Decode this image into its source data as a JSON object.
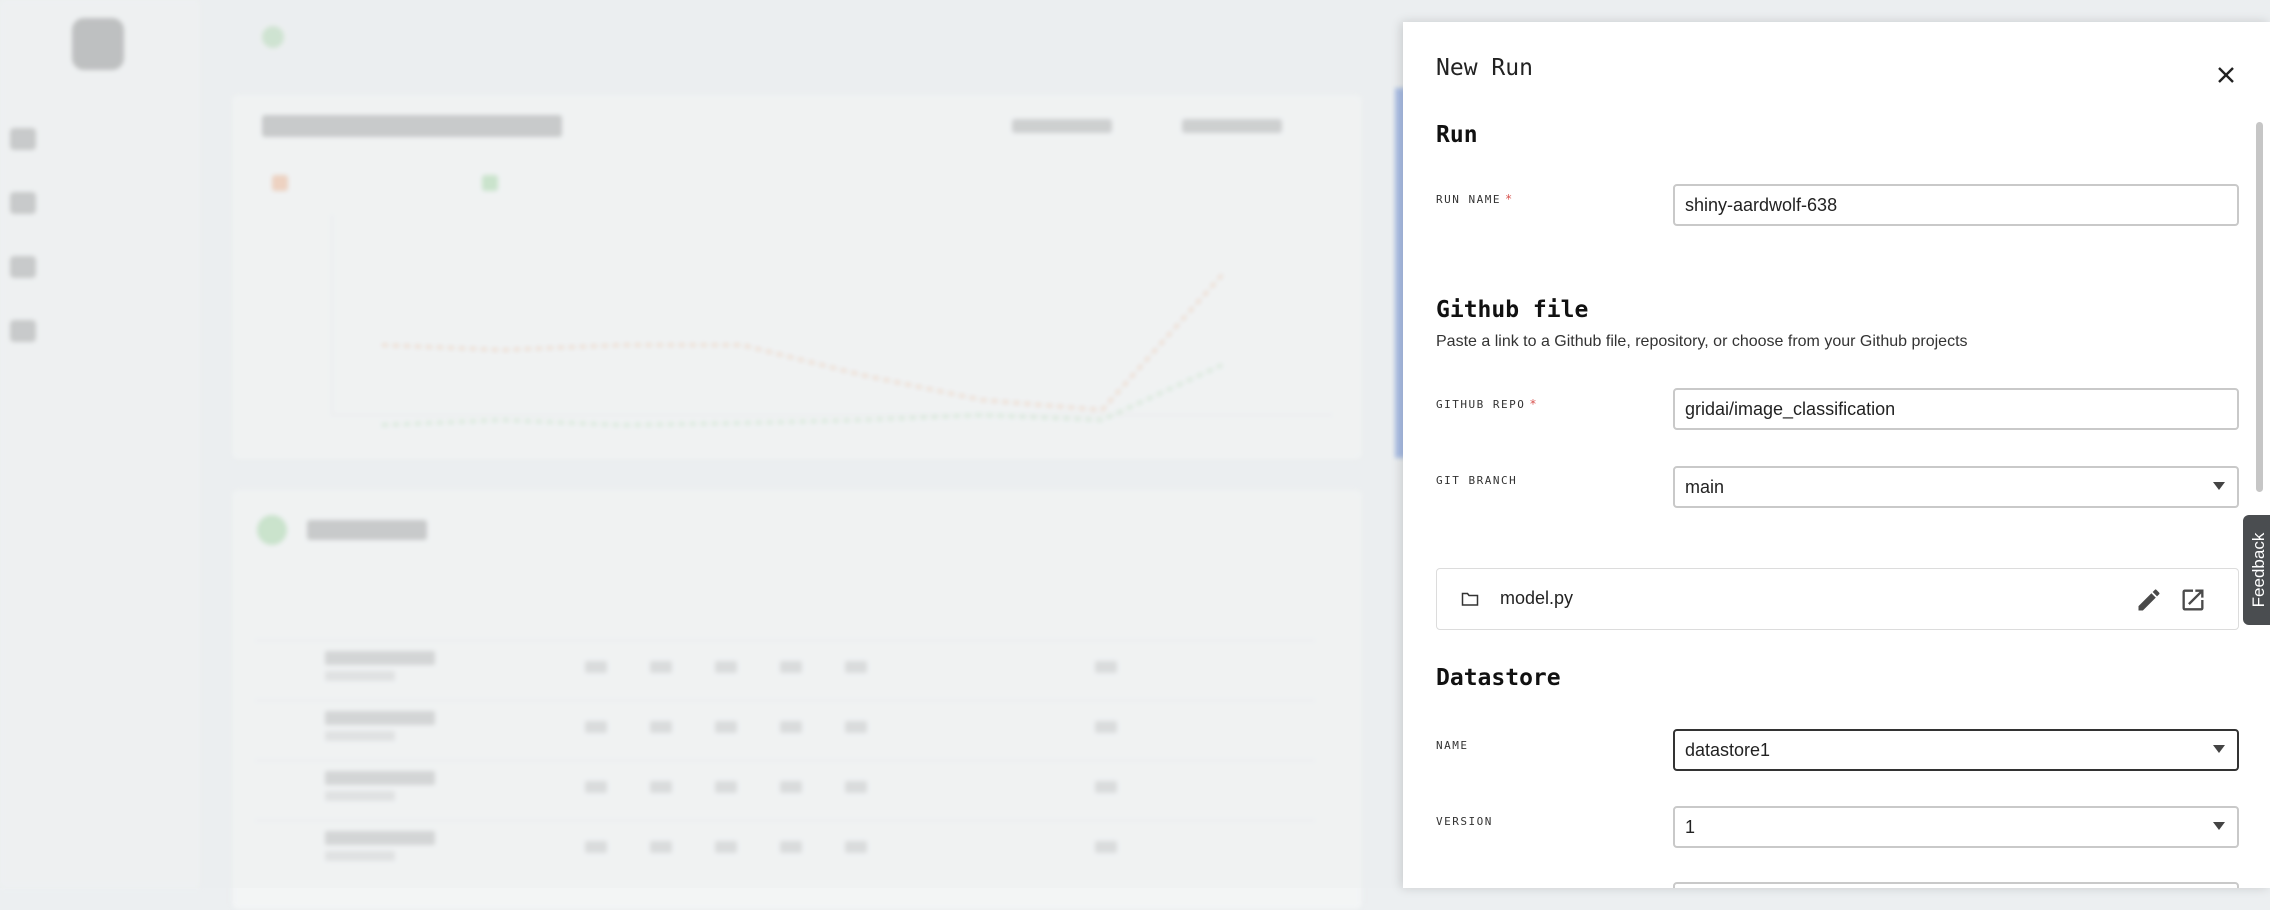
{
  "drawer": {
    "title": "New Run",
    "run_section": {
      "title": "Run",
      "run_name_label": "RUN NAME",
      "run_name_value": "shiny-aardwolf-638",
      "required_mark": "*"
    },
    "github_section": {
      "title": "Github file",
      "description": "Paste a link to a Github file, repository, or choose from your Github projects",
      "repo_label": "GITHUB REPO",
      "repo_value": "gridai/image_classification",
      "required_mark": "*",
      "branch_label": "GIT BRANCH",
      "branch_value": "main",
      "file_name": "model.py"
    },
    "datastore_section": {
      "title": "Datastore",
      "name_label": "NAME",
      "name_value": "datastore1",
      "version_label": "VERSION",
      "version_value": "1"
    }
  },
  "feedback": {
    "label": "Feedback"
  },
  "icons": {
    "close": "close-icon",
    "folder": "folder-icon",
    "edit": "pencil-icon",
    "open": "open-in-new-icon",
    "dropdown": "chevron-down-icon"
  },
  "colors": {
    "required": "#d9534f",
    "feedback_bg": "#4a4d50",
    "focused_border": "#333333"
  }
}
